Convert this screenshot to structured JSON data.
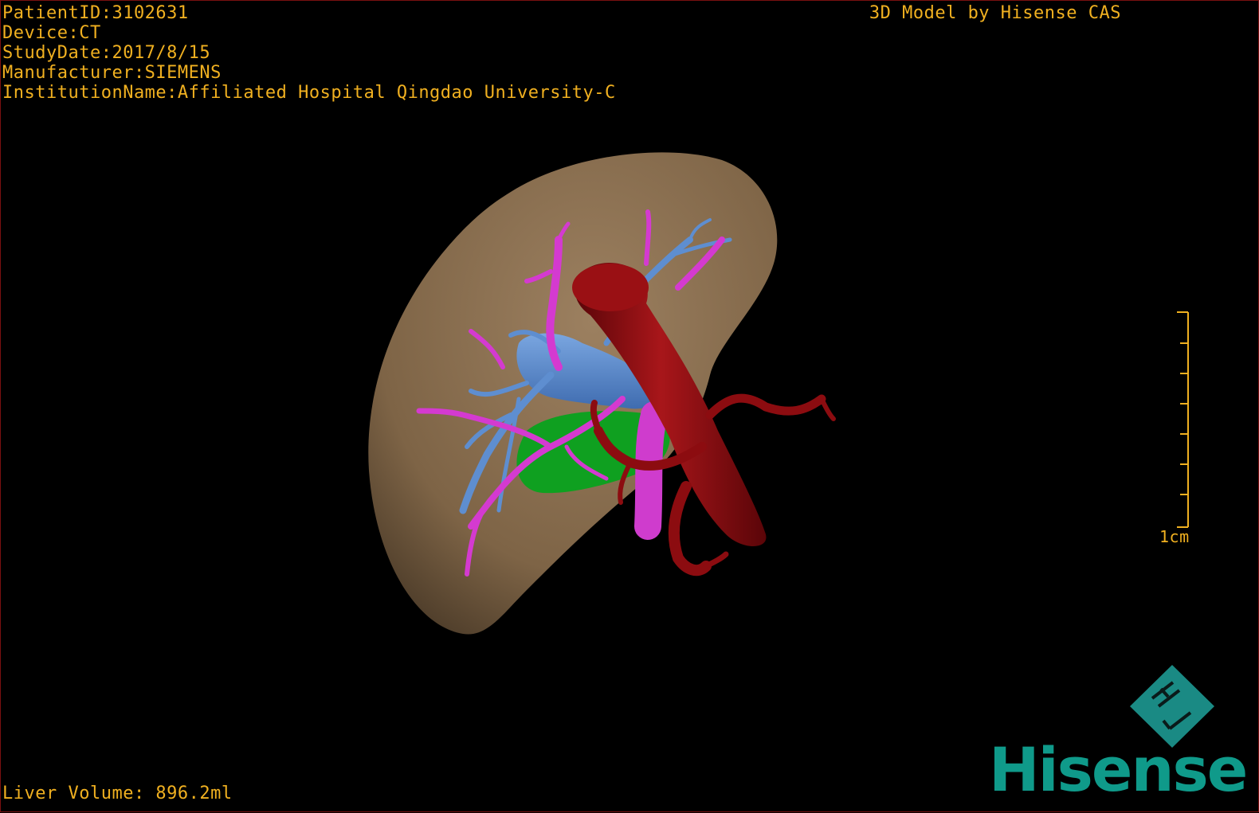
{
  "header": {
    "patient_id": "PatientID:3102631",
    "device": "Device:CT",
    "study_date": "StudyDate:2017/8/15",
    "manufacturer": "Manufacturer:SIEMENS",
    "institution": "InstitutionName:Affiliated Hospital Qingdao University-C"
  },
  "brand_caption": "3D Model by Hisense CAS",
  "footer": {
    "liver_volume": "Liver Volume: 896.2ml"
  },
  "scale_bar": {
    "label": "1cm"
  },
  "logo": {
    "word": "Hisense",
    "mark_icon": "hisense-diamond-mark"
  },
  "colors": {
    "overlay_text": "#f0b020",
    "liver": "#8a6f4e",
    "aorta": "#8c0c10",
    "portal_vein": "#5e8ed0",
    "hepatic_vessels": "#d43ad0",
    "gallbladder": "#0fa020",
    "brand_teal": "#0f9a8a"
  }
}
